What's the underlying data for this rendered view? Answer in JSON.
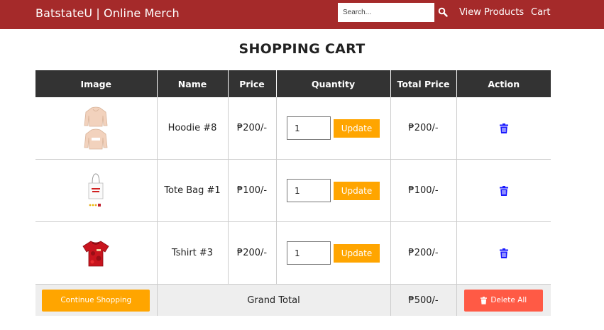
{
  "header": {
    "brand": "BatstateU | Online Merch",
    "search_placeholder": "Search...",
    "search_icon": "magnifier-icon",
    "nav": [
      "View Products",
      "Cart"
    ]
  },
  "page_title": "SHOPPING CART",
  "table": {
    "columns": [
      "Image",
      "Name",
      "Price",
      "Quantity",
      "Total Price",
      "Action"
    ],
    "rows": [
      {
        "image_icon": "hoodie-image",
        "name": "Hoodie #8",
        "price": "₱200/-",
        "quantity": "1",
        "update_label": "Update",
        "total": "₱200/-",
        "action_icon": "trash-icon"
      },
      {
        "image_icon": "tote-bag-image",
        "name": "Tote Bag #1",
        "price": "₱100/-",
        "quantity": "1",
        "update_label": "Update",
        "total": "₱100/-",
        "action_icon": "trash-icon"
      },
      {
        "image_icon": "tshirt-image",
        "name": "Tshirt #3",
        "price": "₱200/-",
        "quantity": "1",
        "update_label": "Update",
        "total": "₱200/-",
        "action_icon": "trash-icon"
      }
    ],
    "footer": {
      "continue_label": "Continue Shopping",
      "grand_total_label": "Grand Total",
      "grand_total_value": "₱500/-",
      "delete_all_label": "Delete All"
    }
  },
  "colors": {
    "topbar": "#a52a2a",
    "table_header": "#333333",
    "accent_orange": "#ffa500",
    "danger": "#ff5a45",
    "trash_icon": "#1a1aff"
  }
}
